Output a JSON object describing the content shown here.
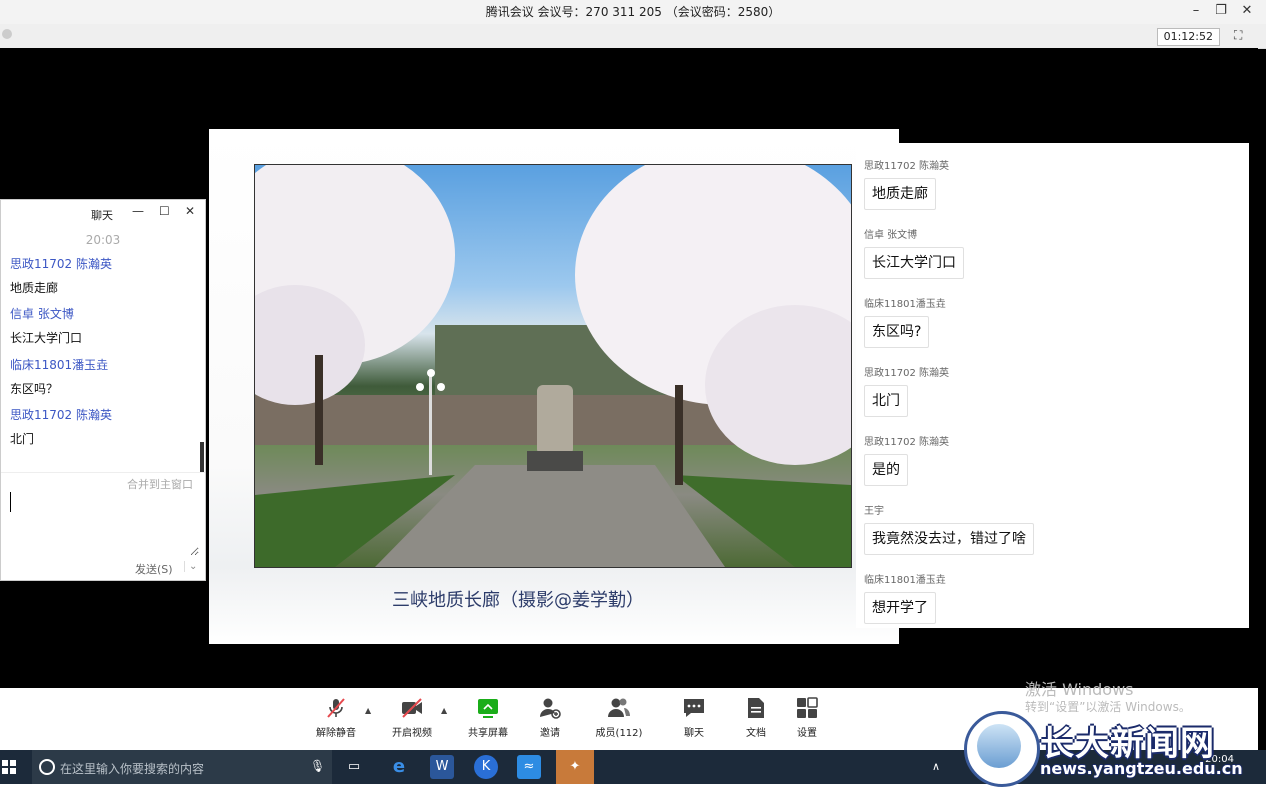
{
  "window": {
    "title": "腾讯会议 会议号：270 311 205 （会议密码：2580）",
    "minimize_icon": "minimize-icon",
    "restore_icon": "restore-icon",
    "close_icon": "close-icon"
  },
  "meeting": {
    "timer": "01:12:52",
    "fullscreen_icon": "fullscreen-icon"
  },
  "slide": {
    "caption": "三峡地质长廊（摄影@姜学勤）"
  },
  "chat_panel": {
    "messages": [
      {
        "sender": "思政11702 陈瀚英",
        "text": "地质走廊"
      },
      {
        "sender": "信卓 张文博",
        "text": "长江大学门口"
      },
      {
        "sender": "临床11801潘玉垚",
        "text": "东区吗?"
      },
      {
        "sender": "思政11702 陈瀚英",
        "text": "北门"
      },
      {
        "sender": "思政11702 陈瀚英",
        "text": "是的"
      },
      {
        "sender": "王宇",
        "text": "我竟然没去过，错过了啥"
      },
      {
        "sender": "临床11801潘玉垚",
        "text": "想开学了"
      }
    ]
  },
  "chat_window": {
    "title": "聊天",
    "time": "20:03",
    "messages": [
      {
        "sender": "思政11702 陈瀚英",
        "text": "地质走廊"
      },
      {
        "sender": "信卓 张文博",
        "text": "长江大学门口"
      },
      {
        "sender": "临床11801潘玉垚",
        "text": "东区吗？"
      },
      {
        "sender": "思政11702 陈瀚英",
        "text": "北门"
      }
    ],
    "merge_label": "合并到主窗口",
    "send_label": "发送(S)",
    "input_value": ""
  },
  "toolbar": {
    "items": [
      {
        "label": "解除静音",
        "icon": "mic-muted-icon"
      },
      {
        "label": "开启视频",
        "icon": "video-off-icon"
      },
      {
        "label": "共享屏幕",
        "icon": "share-screen-icon"
      },
      {
        "label": "邀请",
        "icon": "invite-icon"
      },
      {
        "label": "成员(112)",
        "icon": "members-icon"
      },
      {
        "label": "聊天",
        "icon": "chat-icon"
      },
      {
        "label": "文档",
        "icon": "document-icon"
      },
      {
        "label": "设置",
        "icon": "settings-icon"
      }
    ]
  },
  "activation": {
    "line1": "激活 Windows",
    "line2": "转到“设置”以激活 Windows。"
  },
  "taskbar": {
    "search_placeholder": "在这里输入你要搜索的内容",
    "time": "20:04"
  },
  "watermark": {
    "title": "长大新闻网",
    "url": "news.yangtzeu.edu.cn"
  },
  "colors": {
    "sender_blue": "#3c57c4",
    "share_green": "#1aad19",
    "taskbar": "#1c2a3a"
  }
}
